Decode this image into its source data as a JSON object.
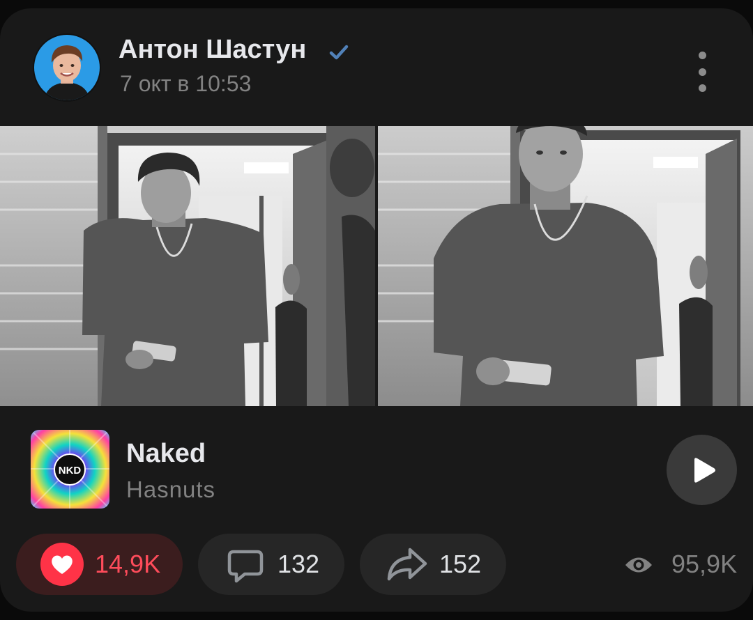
{
  "post": {
    "author_name": "Антон Шастун",
    "verified": true,
    "time": "7 окт в 10:53",
    "photos": [
      {
        "description": "black and white photo, man in t-shirt looking at phone in office doorway"
      },
      {
        "description": "black and white photo, man in t-shirt holding phone, looking at camera"
      }
    ]
  },
  "audio": {
    "title": "Naked",
    "artist": "Hasnuts",
    "cover_text": "NKD"
  },
  "actions": {
    "likes": "14,9K",
    "comments": "132",
    "shares": "152",
    "views": "95,9K",
    "liked": true
  },
  "icons": {
    "verified": "checkmark-icon",
    "more": "more-vertical-icon",
    "play": "play-icon",
    "like": "heart-icon",
    "comment": "comment-icon",
    "share": "share-icon",
    "views": "eye-icon"
  },
  "colors": {
    "card_background": "#191919",
    "like_red": "#ff3347",
    "like_pill": "#3b1d1e",
    "verified_blue": "#5181b8",
    "secondary_text": "#828282"
  }
}
